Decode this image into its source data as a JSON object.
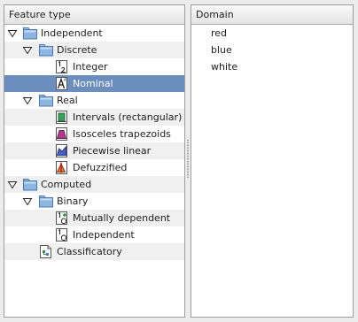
{
  "tree": {
    "header": "Feature type",
    "items": [
      {
        "label": "Independent",
        "icon": "folder-icon"
      },
      {
        "label": "Discrete",
        "icon": "folder-icon"
      },
      {
        "label": "Integer",
        "icon": "integer-12-icon"
      },
      {
        "label": "Nominal",
        "icon": "nominal-a-icon",
        "selected": true
      },
      {
        "label": "Real",
        "icon": "folder-icon"
      },
      {
        "label": "Intervals (rectangular)",
        "icon": "rectangular-intervals-icon"
      },
      {
        "label": "Isosceles trapezoids",
        "icon": "trapezoid-icon"
      },
      {
        "label": "Piecewise linear",
        "icon": "piecewise-linear-icon"
      },
      {
        "label": "Defuzzified",
        "icon": "defuzzified-icon"
      },
      {
        "label": "Computed",
        "icon": "folder-icon"
      },
      {
        "label": "Binary",
        "icon": "folder-icon"
      },
      {
        "label": "Mutually dependent",
        "icon": "mutually-dependent-icon"
      },
      {
        "label": "Independent",
        "icon": "binary-independent-icon"
      },
      {
        "label": "Classificatory",
        "icon": "classificatory-icon"
      }
    ]
  },
  "domain": {
    "header": "Domain",
    "values": [
      "red",
      "blue",
      "white"
    ]
  },
  "colors": {
    "selection": "#6c8ebf",
    "folder": "#8fb6e0",
    "folder_outline": "#4a78b0"
  }
}
